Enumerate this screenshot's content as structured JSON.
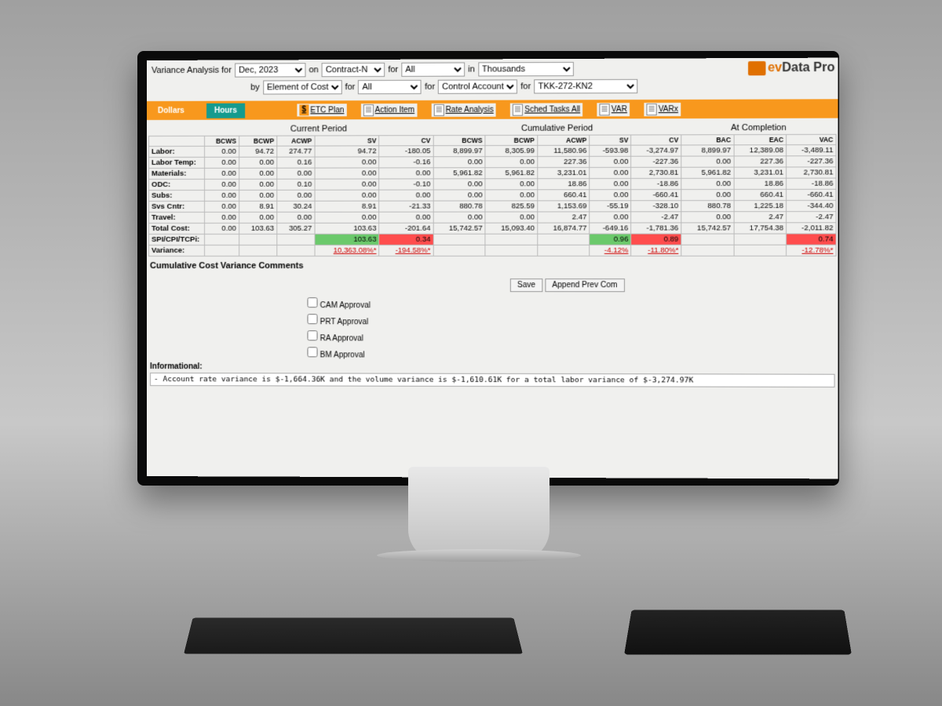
{
  "header": {
    "title": "Variance Analysis for",
    "on": "on",
    "for1": "for",
    "in": "in",
    "by": "by",
    "for2": "for",
    "for3": "for",
    "for4": "for",
    "period": "Dec, 2023",
    "contract": "Contract-N",
    "all1": "All",
    "units": "Thousands",
    "element": "Element of Cost",
    "all2": "All",
    "level": "Control Account",
    "account": "TKK-272-KN2",
    "brand_ev": "ev",
    "brand_rest": "Data Pro"
  },
  "tabs": {
    "dollars": "Dollars",
    "hours": "Hours"
  },
  "tools": {
    "etc": "ETC Plan",
    "action": "Action Item",
    "rate": "Rate Analysis",
    "sched": "Sched Tasks All",
    "var": "VAR",
    "varx": "VARx",
    "dollar": "$"
  },
  "sections": {
    "current": "Current Period",
    "cumulative": "Cumulative Period",
    "completion": "At Completion"
  },
  "cols": {
    "bcws": "BCWS",
    "bcwp": "BCWP",
    "acwp": "ACWP",
    "sv": "SV",
    "cv": "CV",
    "bac": "BAC",
    "eac": "EAC",
    "vac": "VAC"
  },
  "rows": [
    {
      "lbl": "Labor:",
      "c": [
        "0.00",
        "94.72",
        "274.77",
        "94.72",
        "-180.05"
      ],
      "u": [
        "8,899.97",
        "8,305.99",
        "11,580.96",
        "-593.98",
        "-3,274.97"
      ],
      "a": [
        "8,899.97",
        "12,389.08",
        "-3,489.11"
      ]
    },
    {
      "lbl": "Labor Temp:",
      "c": [
        "0.00",
        "0.00",
        "0.16",
        "0.00",
        "-0.16"
      ],
      "u": [
        "0.00",
        "0.00",
        "227.36",
        "0.00",
        "-227.36"
      ],
      "a": [
        "0.00",
        "227.36",
        "-227.36"
      ]
    },
    {
      "lbl": "Materials:",
      "c": [
        "0.00",
        "0.00",
        "0.00",
        "0.00",
        "0.00"
      ],
      "u": [
        "5,961.82",
        "5,961.82",
        "3,231.01",
        "0.00",
        "2,730.81"
      ],
      "a": [
        "5,961.82",
        "3,231.01",
        "2,730.81"
      ]
    },
    {
      "lbl": "ODC:",
      "c": [
        "0.00",
        "0.00",
        "0.10",
        "0.00",
        "-0.10"
      ],
      "u": [
        "0.00",
        "0.00",
        "18.86",
        "0.00",
        "-18.86"
      ],
      "a": [
        "0.00",
        "18.86",
        "-18.86"
      ]
    },
    {
      "lbl": "Subs:",
      "c": [
        "0.00",
        "0.00",
        "0.00",
        "0.00",
        "0.00"
      ],
      "u": [
        "0.00",
        "0.00",
        "660.41",
        "0.00",
        "-660.41"
      ],
      "a": [
        "0.00",
        "660.41",
        "-660.41"
      ]
    },
    {
      "lbl": "Svs Cntr:",
      "c": [
        "0.00",
        "8.91",
        "30.24",
        "8.91",
        "-21.33"
      ],
      "u": [
        "880.78",
        "825.59",
        "1,153.69",
        "-55.19",
        "-328.10"
      ],
      "a": [
        "880.78",
        "1,225.18",
        "-344.40"
      ]
    },
    {
      "lbl": "Travel:",
      "c": [
        "0.00",
        "0.00",
        "0.00",
        "0.00",
        "0.00"
      ],
      "u": [
        "0.00",
        "0.00",
        "2.47",
        "0.00",
        "-2.47"
      ],
      "a": [
        "0.00",
        "2.47",
        "-2.47"
      ]
    },
    {
      "lbl": "Total Cost:",
      "c": [
        "0.00",
        "103.63",
        "305.27",
        "103.63",
        "-201.64"
      ],
      "u": [
        "15,742.57",
        "15,093.40",
        "16,874.77",
        "-649.16",
        "-1,781.36"
      ],
      "a": [
        "15,742.57",
        "17,754.38",
        "-2,011.82"
      ]
    }
  ],
  "spi": {
    "lbl": "SPI/CPI/TCPi:",
    "c_sv": "103.63",
    "c_cv": "0.34",
    "u_sv": "0.96",
    "u_cv": "0.89",
    "a_vac": "0.74"
  },
  "variance": {
    "lbl": "Variance:",
    "c_sv": "10,363.08%*",
    "c_cv": "-194.58%*",
    "u_sv": "-4.12%",
    "u_cv": "-11.80%*",
    "a_vac": "-12.78%*"
  },
  "comments": {
    "title": "Cumulative Cost Variance Comments",
    "save": "Save",
    "append": "Append Prev Com",
    "cam": "CAM Approval",
    "prt": "PRT Approval",
    "ra": "RA Approval",
    "bm": "BM Approval",
    "info_lbl": "Informational:",
    "info_text": "- Account rate variance is $-1,664.36K and the volume variance is $-1,610.61K for a total labor variance of $-3,274.97K"
  }
}
